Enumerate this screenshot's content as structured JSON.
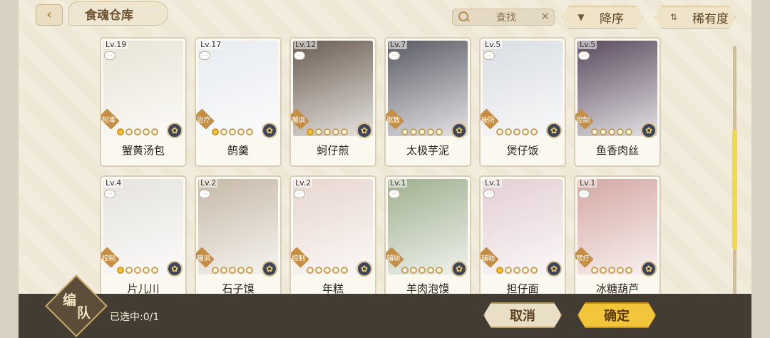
{
  "header": {
    "title": "食魂仓库",
    "search_placeholder": "查找",
    "sort_label": "降序",
    "rarity_label": "稀有度"
  },
  "cards": [
    {
      "level": "Lv.19",
      "role": "附毒",
      "name": "蟹黄汤包",
      "stars": 1,
      "art_color": "#e9e3d6"
    },
    {
      "level": "Lv.17",
      "role": "治疗",
      "name": "鹄羹",
      "stars": 1,
      "art_color": "#e7ebf0"
    },
    {
      "level": "Lv.12",
      "role": "嘲讽",
      "name": "蚵仔煎",
      "stars": 1,
      "art_color": "#6b5c50"
    },
    {
      "level": "Lv.7",
      "role": "驱散",
      "name": "太极芋泥",
      "stars": 0,
      "art_color": "#5b5b66"
    },
    {
      "level": "Lv.5",
      "role": "破防",
      "name": "煲仔饭",
      "stars": 0,
      "art_color": "#d9dde2"
    },
    {
      "level": "Lv.5",
      "role": "控制",
      "name": "鱼香肉丝",
      "stars": 0,
      "art_color": "#5a4a5e"
    },
    {
      "level": "Lv.4",
      "role": "控制",
      "name": "片儿川",
      "stars": 1,
      "art_color": "#e6e3de"
    },
    {
      "level": "Lv.2",
      "role": "嘲讽",
      "name": "石子馍",
      "stars": 0,
      "art_color": "#c6b9a7"
    },
    {
      "level": "Lv.2",
      "role": "控制",
      "name": "年糕",
      "stars": 0,
      "art_color": "#e7d6cf"
    },
    {
      "level": "Lv.1",
      "role": "辅助",
      "name": "羊肉泡馍",
      "stars": 0,
      "art_color": "#9fb08f"
    },
    {
      "level": "Lv.1",
      "role": "辅助",
      "name": "担仔面",
      "stars": 1,
      "art_color": "#e3cfd3"
    },
    {
      "level": "Lv.1",
      "role": "禁疗",
      "name": "冰糖葫芦",
      "stars": 0,
      "art_color": "#d4a8a3"
    }
  ],
  "footer": {
    "team_char1": "编",
    "team_char2": "队",
    "selected_text": "已选中:0/1",
    "cancel_label": "取消",
    "confirm_label": "确定"
  }
}
